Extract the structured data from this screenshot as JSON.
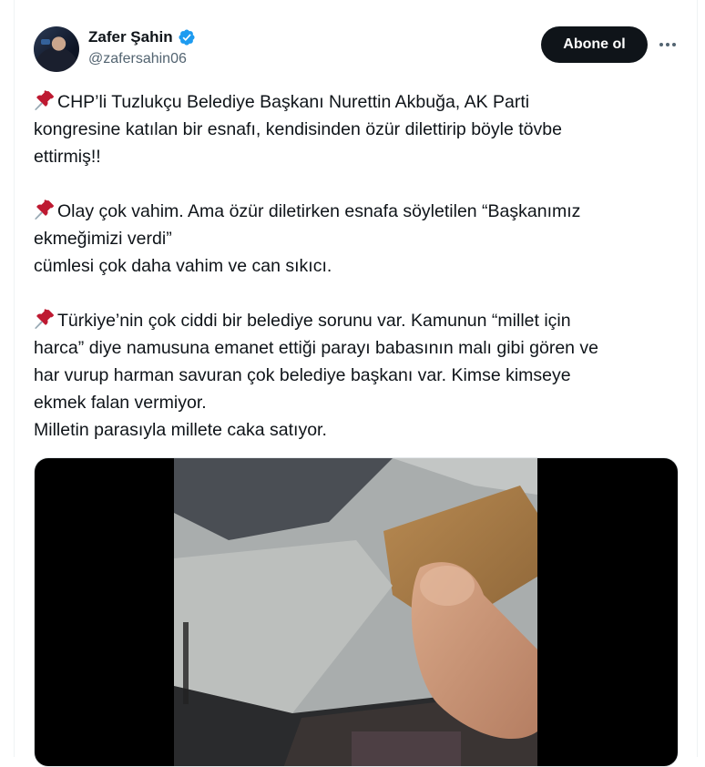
{
  "author": {
    "name": "Zafer Şahin",
    "handle": "@zafersahin06",
    "verified": true,
    "avatar_icon": "avatar-photo"
  },
  "actions": {
    "follow_label": "Abone ol",
    "more_icon": "more-dots-icon"
  },
  "tweet": {
    "paragraphs": [
      "CHP’li Tuzlukçu Belediye Başkanı Nurettin Akbuğa, AK Parti\nkongresine katılan bir esnafı,  kendisinden özür dilettirip böyle tövbe\nettirmiş!!",
      "Olay çok vahim. Ama özür diletirken esnafa söyletilen “Başkanımız\nekmeğimizi verdi”\ncümlesi çok daha vahim ve can sıkıcı.",
      "Türkiye’nin çok ciddi bir belediye sorunu var. Kamunun “millet için\nharca” diye namusuna emanet ettiği parayı babasının malı gibi gören ve\nhar vurup harman savuran çok belediye başkanı var. Kimse kimseye\nekmek falan vermiyor.\nMilletin parasıyla millete caka satıyor."
    ],
    "paragraph_icon": "pushpin-icon"
  },
  "media": {
    "type": "video",
    "background": "#000000"
  },
  "colors": {
    "text": "#0f1419",
    "secondary": "#536471",
    "verified": "#1d9bf0",
    "button_bg": "#0f1419"
  }
}
